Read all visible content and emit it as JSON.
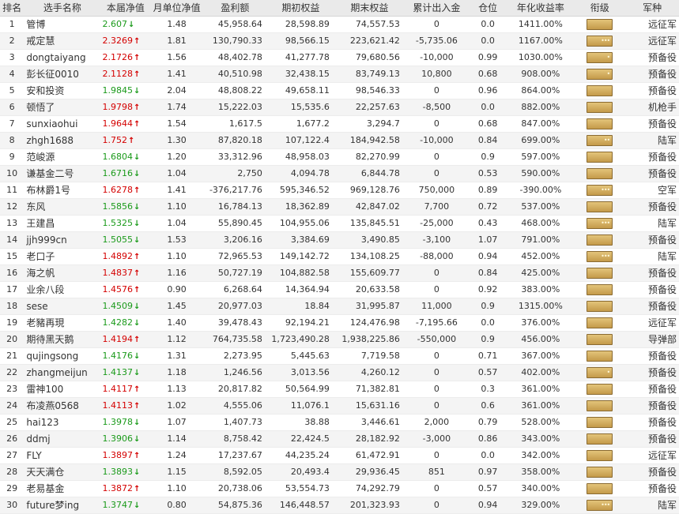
{
  "colors": {
    "up": "#d40000",
    "down": "#1a9a1a",
    "header_bg": "#eaeaea",
    "badge": "#c49a4a"
  },
  "header": {
    "rank": "排名",
    "name": "选手名称",
    "nav": "本届净值",
    "monthly": "月单位净值",
    "profit": "盈利额",
    "start_equity": "期初权益",
    "end_equity": "期末权益",
    "flow": "累计出入金",
    "position": "仓位",
    "annual": "年化收益率",
    "level": "衔级",
    "army": "军种"
  },
  "rows": [
    {
      "rank": "1",
      "name": "管博",
      "nav": "2.607",
      "dir": "down",
      "monthly": "1.48",
      "profit": "45,958.64",
      "start": "28,598.89",
      "end": "74,557.53",
      "flow": "0",
      "pos": "0.0",
      "annual": "1411.00%",
      "insignia": "",
      "army": "远征军"
    },
    {
      "rank": "2",
      "name": "戒定慧",
      "nav": "2.3269",
      "dir": "up",
      "monthly": "1.81",
      "profit": "130,790.33",
      "start": "98,566.15",
      "end": "223,621.42",
      "flow": "-5,735.06",
      "pos": "0.0",
      "annual": "1167.00%",
      "insignia": "•••",
      "army": "远征军"
    },
    {
      "rank": "3",
      "name": "dongtaiyang",
      "nav": "2.1726",
      "dir": "up",
      "monthly": "1.56",
      "profit": "48,402.78",
      "start": "41,277.78",
      "end": "79,680.56",
      "flow": "-10,000",
      "pos": "0.99",
      "annual": "1030.00%",
      "insignia": "•",
      "army": "预备役"
    },
    {
      "rank": "4",
      "name": "彭长征0010",
      "nav": "2.1128",
      "dir": "up",
      "monthly": "1.41",
      "profit": "40,510.98",
      "start": "32,438.15",
      "end": "83,749.13",
      "flow": "10,800",
      "pos": "0.68",
      "annual": "908.00%",
      "insignia": "•",
      "army": "预备役"
    },
    {
      "rank": "5",
      "name": "安和投资",
      "nav": "1.9845",
      "dir": "down",
      "monthly": "2.04",
      "profit": "48,808.22",
      "start": "49,658.11",
      "end": "98,546.33",
      "flow": "0",
      "pos": "0.96",
      "annual": "864.00%",
      "insignia": "",
      "army": "预备役"
    },
    {
      "rank": "6",
      "name": "顿悟了",
      "nav": "1.9798",
      "dir": "up",
      "monthly": "1.74",
      "profit": "15,222.03",
      "start": "15,535.6",
      "end": "22,257.63",
      "flow": "-8,500",
      "pos": "0.0",
      "annual": "882.00%",
      "insignia": "",
      "army": "机枪手"
    },
    {
      "rank": "7",
      "name": "sunxiaohui",
      "nav": "1.9644",
      "dir": "up",
      "monthly": "1.54",
      "profit": "1,617.5",
      "start": "1,677.2",
      "end": "3,294.7",
      "flow": "0",
      "pos": "0.68",
      "annual": "847.00%",
      "insignia": "",
      "army": "预备役"
    },
    {
      "rank": "8",
      "name": "zhgh1688",
      "nav": "1.752",
      "dir": "up",
      "monthly": "1.30",
      "profit": "87,820.18",
      "start": "107,122.4",
      "end": "184,942.58",
      "flow": "-10,000",
      "pos": "0.84",
      "annual": "699.00%",
      "insignia": "••",
      "army": "陆军"
    },
    {
      "rank": "9",
      "name": "范峻源",
      "nav": "1.6804",
      "dir": "down",
      "monthly": "1.20",
      "profit": "33,312.96",
      "start": "48,958.03",
      "end": "82,270.99",
      "flow": "0",
      "pos": "0.9",
      "annual": "597.00%",
      "insignia": "",
      "army": "预备役"
    },
    {
      "rank": "10",
      "name": "谦基金二号",
      "nav": "1.6716",
      "dir": "down",
      "monthly": "1.04",
      "profit": "2,750",
      "start": "4,094.78",
      "end": "6,844.78",
      "flow": "0",
      "pos": "0.53",
      "annual": "590.00%",
      "insignia": "",
      "army": "预备役"
    },
    {
      "rank": "11",
      "name": "布林爵1号",
      "nav": "1.6278",
      "dir": "up",
      "monthly": "1.41",
      "profit": "-376,217.76",
      "start": "595,346.52",
      "end": "969,128.76",
      "flow": "750,000",
      "pos": "0.89",
      "annual": "-390.00%",
      "insignia": "•••",
      "army": "空军"
    },
    {
      "rank": "12",
      "name": "东风",
      "nav": "1.5856",
      "dir": "down",
      "monthly": "1.10",
      "profit": "16,784.13",
      "start": "18,362.89",
      "end": "42,847.02",
      "flow": "7,700",
      "pos": "0.72",
      "annual": "537.00%",
      "insignia": "",
      "army": "预备役"
    },
    {
      "rank": "13",
      "name": "王建昌",
      "nav": "1.5325",
      "dir": "down",
      "monthly": "1.04",
      "profit": "55,890.45",
      "start": "104,955.06",
      "end": "135,845.51",
      "flow": "-25,000",
      "pos": "0.43",
      "annual": "468.00%",
      "insignia": "•••",
      "army": "陆军"
    },
    {
      "rank": "14",
      "name": "jjh999cn",
      "nav": "1.5055",
      "dir": "down",
      "monthly": "1.53",
      "profit": "3,206.16",
      "start": "3,384.69",
      "end": "3,490.85",
      "flow": "-3,100",
      "pos": "1.07",
      "annual": "791.00%",
      "insignia": "",
      "army": "预备役"
    },
    {
      "rank": "15",
      "name": "老口子",
      "nav": "1.4892",
      "dir": "up",
      "monthly": "1.10",
      "profit": "72,965.53",
      "start": "149,142.72",
      "end": "134,108.25",
      "flow": "-88,000",
      "pos": "0.94",
      "annual": "452.00%",
      "insignia": "•••",
      "army": "陆军"
    },
    {
      "rank": "16",
      "name": "海之帆",
      "nav": "1.4837",
      "dir": "up",
      "monthly": "1.16",
      "profit": "50,727.19",
      "start": "104,882.58",
      "end": "155,609.77",
      "flow": "0",
      "pos": "0.84",
      "annual": "425.00%",
      "insignia": "",
      "army": "预备役"
    },
    {
      "rank": "17",
      "name": "业余八段",
      "nav": "1.4576",
      "dir": "up",
      "monthly": "0.90",
      "profit": "6,268.64",
      "start": "14,364.94",
      "end": "20,633.58",
      "flow": "0",
      "pos": "0.92",
      "annual": "383.00%",
      "insignia": "",
      "army": "预备役"
    },
    {
      "rank": "18",
      "name": "sese",
      "nav": "1.4509",
      "dir": "down",
      "monthly": "1.45",
      "profit": "20,977.03",
      "start": "18.84",
      "end": "31,995.87",
      "flow": "11,000",
      "pos": "0.9",
      "annual": "1315.00%",
      "insignia": "",
      "army": "预备役"
    },
    {
      "rank": "19",
      "name": "老豬再現",
      "nav": "1.4282",
      "dir": "down",
      "monthly": "1.40",
      "profit": "39,478.43",
      "start": "92,194.21",
      "end": "124,476.98",
      "flow": "-7,195.66",
      "pos": "0.0",
      "annual": "376.00%",
      "insignia": "",
      "army": "远征军"
    },
    {
      "rank": "20",
      "name": "期待黑天鹅",
      "nav": "1.4194",
      "dir": "up",
      "monthly": "1.12",
      "profit": "764,735.58",
      "start": "1,723,490.28",
      "end": "1,938,225.86",
      "flow": "-550,000",
      "pos": "0.9",
      "annual": "456.00%",
      "insignia": "",
      "army": "导弹部"
    },
    {
      "rank": "21",
      "name": "qujingsong",
      "nav": "1.4176",
      "dir": "down",
      "monthly": "1.31",
      "profit": "2,273.95",
      "start": "5,445.63",
      "end": "7,719.58",
      "flow": "0",
      "pos": "0.71",
      "annual": "367.00%",
      "insignia": "",
      "army": "预备役"
    },
    {
      "rank": "22",
      "name": "zhangmeijun",
      "nav": "1.4137",
      "dir": "down",
      "monthly": "1.18",
      "profit": "1,246.56",
      "start": "3,013.56",
      "end": "4,260.12",
      "flow": "0",
      "pos": "0.57",
      "annual": "402.00%",
      "insignia": "•",
      "army": "预备役"
    },
    {
      "rank": "23",
      "name": "雷神100",
      "nav": "1.4117",
      "dir": "up",
      "monthly": "1.13",
      "profit": "20,817.82",
      "start": "50,564.99",
      "end": "71,382.81",
      "flow": "0",
      "pos": "0.3",
      "annual": "361.00%",
      "insignia": "",
      "army": "预备役"
    },
    {
      "rank": "24",
      "name": "布凌燕0568",
      "nav": "1.4113",
      "dir": "up",
      "monthly": "1.02",
      "profit": "4,555.06",
      "start": "11,076.1",
      "end": "15,631.16",
      "flow": "0",
      "pos": "0.6",
      "annual": "361.00%",
      "insignia": "",
      "army": "预备役"
    },
    {
      "rank": "25",
      "name": "hai123",
      "nav": "1.3978",
      "dir": "down",
      "monthly": "1.07",
      "profit": "1,407.73",
      "start": "38.88",
      "end": "3,446.61",
      "flow": "2,000",
      "pos": "0.79",
      "annual": "528.00%",
      "insignia": "",
      "army": "预备役"
    },
    {
      "rank": "26",
      "name": "ddmj",
      "nav": "1.3906",
      "dir": "down",
      "monthly": "1.14",
      "profit": "8,758.42",
      "start": "22,424.5",
      "end": "28,182.92",
      "flow": "-3,000",
      "pos": "0.86",
      "annual": "343.00%",
      "insignia": "",
      "army": "预备役"
    },
    {
      "rank": "27",
      "name": "FLY",
      "nav": "1.3897",
      "dir": "up",
      "monthly": "1.24",
      "profit": "17,237.67",
      "start": "44,235.24",
      "end": "61,472.91",
      "flow": "0",
      "pos": "0.0",
      "annual": "342.00%",
      "insignia": "",
      "army": "远征军"
    },
    {
      "rank": "28",
      "name": "天天满仓",
      "nav": "1.3893",
      "dir": "down",
      "monthly": "1.15",
      "profit": "8,592.05",
      "start": "20,493.4",
      "end": "29,936.45",
      "flow": "851",
      "pos": "0.97",
      "annual": "358.00%",
      "insignia": "",
      "army": "预备役"
    },
    {
      "rank": "29",
      "name": "老易基金",
      "nav": "1.3872",
      "dir": "up",
      "monthly": "1.10",
      "profit": "20,738.06",
      "start": "53,554.73",
      "end": "74,292.79",
      "flow": "0",
      "pos": "0.57",
      "annual": "340.00%",
      "insignia": "",
      "army": "预备役"
    },
    {
      "rank": "30",
      "name": "future梦ing",
      "nav": "1.3747",
      "dir": "down",
      "monthly": "0.80",
      "profit": "54,875.36",
      "start": "146,448.57",
      "end": "201,323.93",
      "flow": "0",
      "pos": "0.94",
      "annual": "329.00%",
      "insignia": "•••",
      "army": "陆军"
    }
  ]
}
